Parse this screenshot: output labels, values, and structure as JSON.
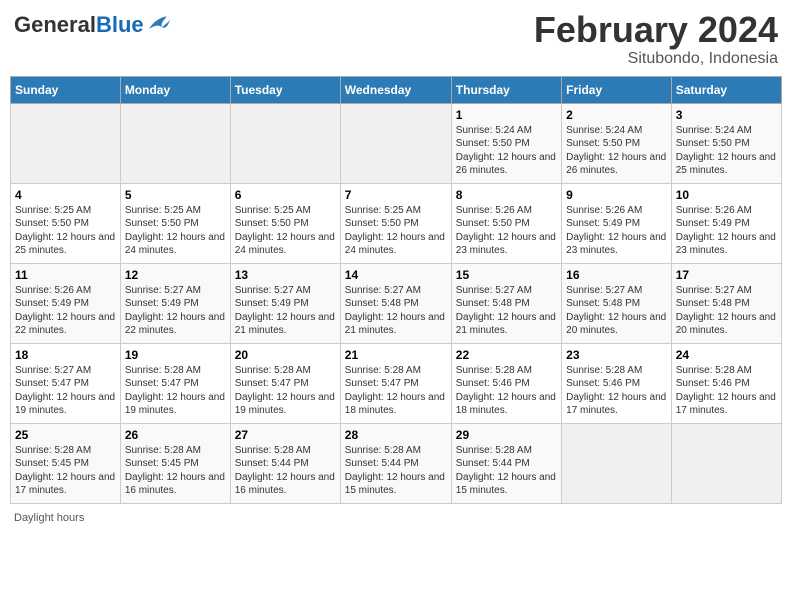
{
  "header": {
    "logo_general": "General",
    "logo_blue": "Blue",
    "main_title": "February 2024",
    "subtitle": "Situbondo, Indonesia"
  },
  "footer": {
    "daylight_label": "Daylight hours"
  },
  "weekdays": [
    "Sunday",
    "Monday",
    "Tuesday",
    "Wednesday",
    "Thursday",
    "Friday",
    "Saturday"
  ],
  "weeks": [
    [
      {
        "day": "",
        "empty": true
      },
      {
        "day": "",
        "empty": true
      },
      {
        "day": "",
        "empty": true
      },
      {
        "day": "",
        "empty": true
      },
      {
        "day": "1",
        "sunrise": "5:24 AM",
        "sunset": "5:50 PM",
        "daylight": "12 hours and 26 minutes."
      },
      {
        "day": "2",
        "sunrise": "5:24 AM",
        "sunset": "5:50 PM",
        "daylight": "12 hours and 26 minutes."
      },
      {
        "day": "3",
        "sunrise": "5:24 AM",
        "sunset": "5:50 PM",
        "daylight": "12 hours and 25 minutes."
      }
    ],
    [
      {
        "day": "4",
        "sunrise": "5:25 AM",
        "sunset": "5:50 PM",
        "daylight": "12 hours and 25 minutes."
      },
      {
        "day": "5",
        "sunrise": "5:25 AM",
        "sunset": "5:50 PM",
        "daylight": "12 hours and 24 minutes."
      },
      {
        "day": "6",
        "sunrise": "5:25 AM",
        "sunset": "5:50 PM",
        "daylight": "12 hours and 24 minutes."
      },
      {
        "day": "7",
        "sunrise": "5:25 AM",
        "sunset": "5:50 PM",
        "daylight": "12 hours and 24 minutes."
      },
      {
        "day": "8",
        "sunrise": "5:26 AM",
        "sunset": "5:50 PM",
        "daylight": "12 hours and 23 minutes."
      },
      {
        "day": "9",
        "sunrise": "5:26 AM",
        "sunset": "5:49 PM",
        "daylight": "12 hours and 23 minutes."
      },
      {
        "day": "10",
        "sunrise": "5:26 AM",
        "sunset": "5:49 PM",
        "daylight": "12 hours and 23 minutes."
      }
    ],
    [
      {
        "day": "11",
        "sunrise": "5:26 AM",
        "sunset": "5:49 PM",
        "daylight": "12 hours and 22 minutes."
      },
      {
        "day": "12",
        "sunrise": "5:27 AM",
        "sunset": "5:49 PM",
        "daylight": "12 hours and 22 minutes."
      },
      {
        "day": "13",
        "sunrise": "5:27 AM",
        "sunset": "5:49 PM",
        "daylight": "12 hours and 21 minutes."
      },
      {
        "day": "14",
        "sunrise": "5:27 AM",
        "sunset": "5:48 PM",
        "daylight": "12 hours and 21 minutes."
      },
      {
        "day": "15",
        "sunrise": "5:27 AM",
        "sunset": "5:48 PM",
        "daylight": "12 hours and 21 minutes."
      },
      {
        "day": "16",
        "sunrise": "5:27 AM",
        "sunset": "5:48 PM",
        "daylight": "12 hours and 20 minutes."
      },
      {
        "day": "17",
        "sunrise": "5:27 AM",
        "sunset": "5:48 PM",
        "daylight": "12 hours and 20 minutes."
      }
    ],
    [
      {
        "day": "18",
        "sunrise": "5:27 AM",
        "sunset": "5:47 PM",
        "daylight": "12 hours and 19 minutes."
      },
      {
        "day": "19",
        "sunrise": "5:28 AM",
        "sunset": "5:47 PM",
        "daylight": "12 hours and 19 minutes."
      },
      {
        "day": "20",
        "sunrise": "5:28 AM",
        "sunset": "5:47 PM",
        "daylight": "12 hours and 19 minutes."
      },
      {
        "day": "21",
        "sunrise": "5:28 AM",
        "sunset": "5:47 PM",
        "daylight": "12 hours and 18 minutes."
      },
      {
        "day": "22",
        "sunrise": "5:28 AM",
        "sunset": "5:46 PM",
        "daylight": "12 hours and 18 minutes."
      },
      {
        "day": "23",
        "sunrise": "5:28 AM",
        "sunset": "5:46 PM",
        "daylight": "12 hours and 17 minutes."
      },
      {
        "day": "24",
        "sunrise": "5:28 AM",
        "sunset": "5:46 PM",
        "daylight": "12 hours and 17 minutes."
      }
    ],
    [
      {
        "day": "25",
        "sunrise": "5:28 AM",
        "sunset": "5:45 PM",
        "daylight": "12 hours and 17 minutes."
      },
      {
        "day": "26",
        "sunrise": "5:28 AM",
        "sunset": "5:45 PM",
        "daylight": "12 hours and 16 minutes."
      },
      {
        "day": "27",
        "sunrise": "5:28 AM",
        "sunset": "5:44 PM",
        "daylight": "12 hours and 16 minutes."
      },
      {
        "day": "28",
        "sunrise": "5:28 AM",
        "sunset": "5:44 PM",
        "daylight": "12 hours and 15 minutes."
      },
      {
        "day": "29",
        "sunrise": "5:28 AM",
        "sunset": "5:44 PM",
        "daylight": "12 hours and 15 minutes."
      },
      {
        "day": "",
        "empty": true
      },
      {
        "day": "",
        "empty": true
      }
    ]
  ]
}
